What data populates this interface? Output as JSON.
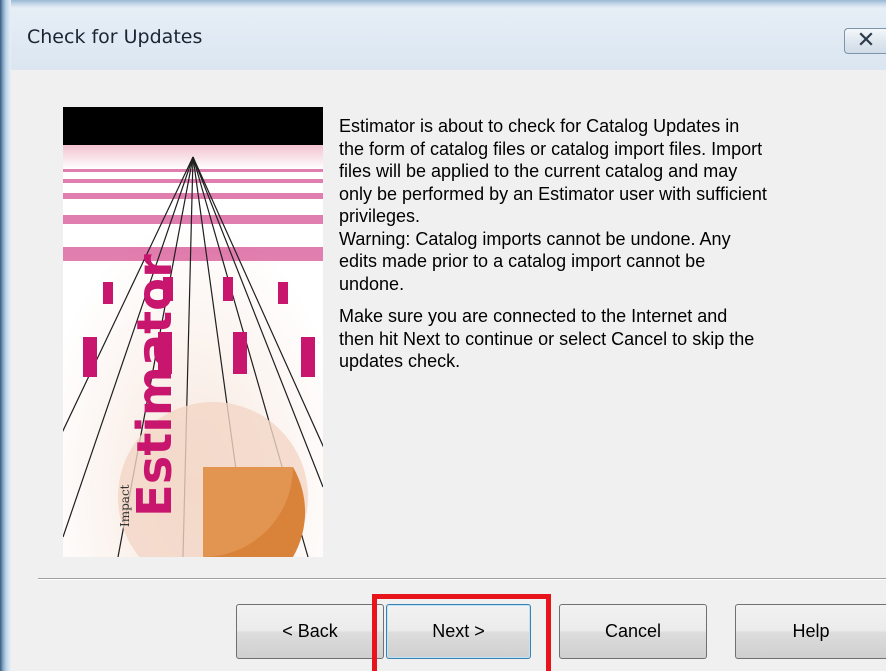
{
  "window": {
    "title": "Check for Updates",
    "close_icon": "close-x-icon"
  },
  "splash_image": {
    "icon": "estimator-splash-image",
    "brand_word": "Estimator",
    "accent_color": "#c8156e"
  },
  "message": {
    "paragraph1": "Estimator is about to check for Catalog Updates in\nthe form of catalog files or catalog import files. Import\nfiles will be applied to the current catalog and may\nonly be performed by an Estimator user with sufficient\nprivileges.\nWarning:  Catalog imports cannot be undone.  Any\nedits made prior to a catalog import cannot be\nundone.",
    "paragraph2": "Make sure you are connected to the Internet and\nthen hit Next to continue or select Cancel to skip the\nupdates check."
  },
  "buttons": {
    "back": "< Back",
    "next": "Next >",
    "cancel": "Cancel",
    "help": "Help"
  },
  "annotation": {
    "highlight_color": "#e8141c"
  }
}
